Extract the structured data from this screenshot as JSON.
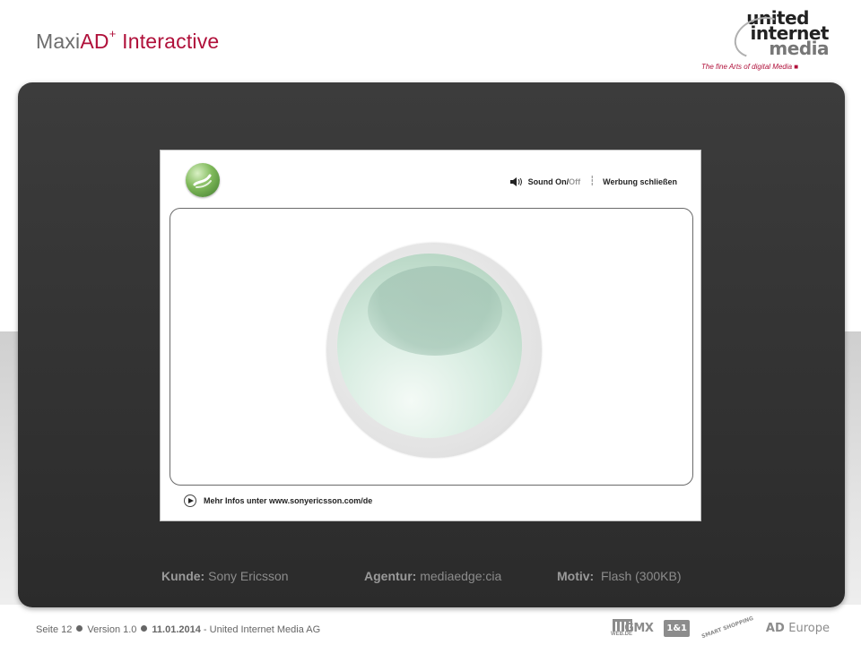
{
  "slide": {
    "title_main": "Maxi",
    "title_accent": "AD",
    "title_sup": "+",
    "title_rest": " Interactive"
  },
  "logo": {
    "line1": "united",
    "line2": "internet",
    "line3": "media",
    "tagline": "The fine Arts of digital Media ■"
  },
  "ad": {
    "sound_on": "Sound On/",
    "sound_off": "Off",
    "separator": "┆",
    "close": "Werbung schließen",
    "more_info": "Mehr Infos unter www.sonyericsson.com/de"
  },
  "caption": {
    "kunde_label": "Kunde:",
    "kunde_value": "Sony Ericsson",
    "agentur_label": "Agentur:",
    "agentur_value": "mediaedge:cia",
    "motiv_label": "Motiv:",
    "motiv_value": "Flash (300KB)"
  },
  "footer": {
    "page": "Seite 12",
    "version": "Version 1.0",
    "date": "11.01.2014",
    "company": " - United Internet Media AG"
  },
  "brands": {
    "webde": "WEB.DE",
    "gmx": "GMX",
    "einsundeins": "1&1",
    "smart": "SMART SHOPPING",
    "ad": "AD",
    "europe": "Europe"
  },
  "colors": {
    "accent": "#b0103a",
    "panel": "#333333",
    "text_gray": "#8c8c8c"
  }
}
